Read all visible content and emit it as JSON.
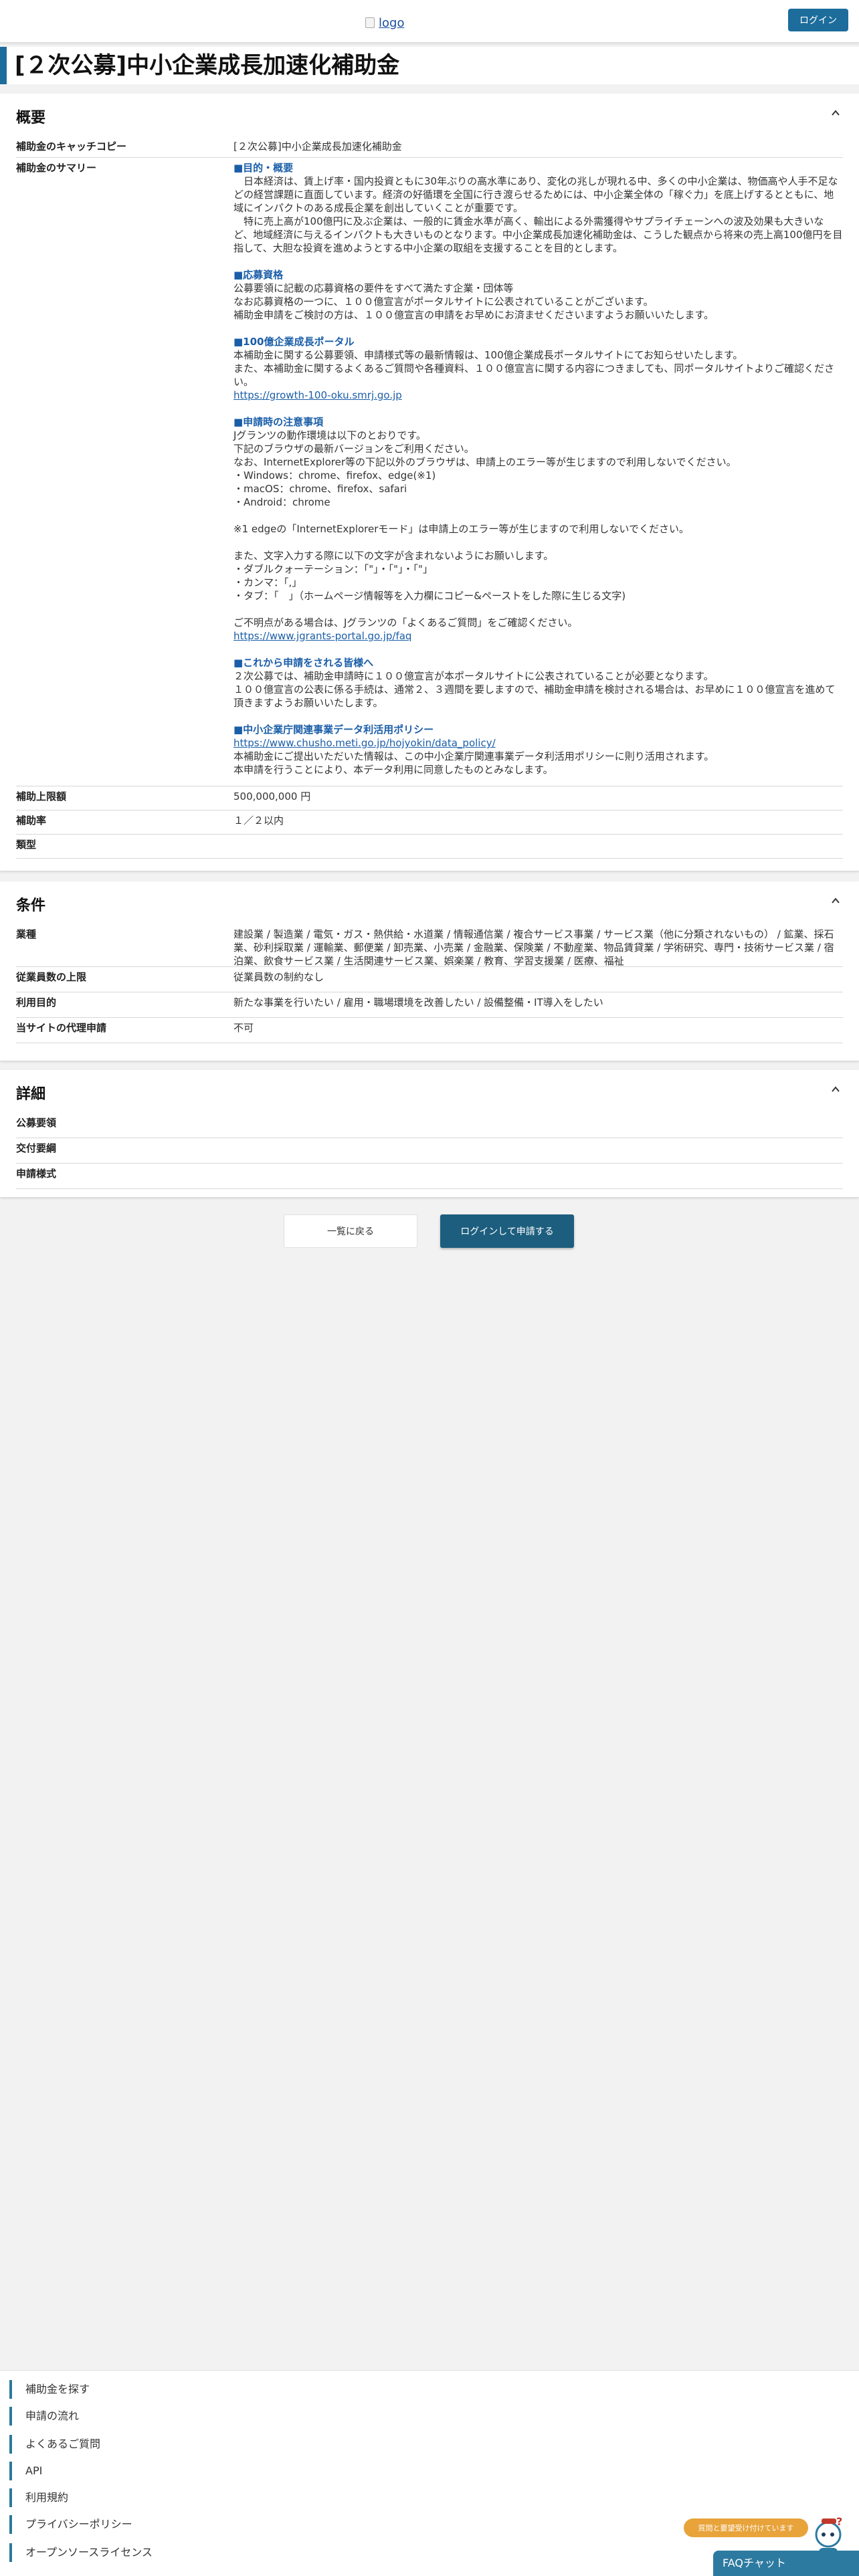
{
  "header": {
    "logo_alt": "logo",
    "login_label": "ログイン"
  },
  "page_title": "[２次公募]中小企業成長加速化補助金",
  "overview": {
    "title": "概要",
    "catchcopy_label": "補助金のキャッチコピー",
    "catchcopy_value": "[２次公募]中小企業成長加速化補助金",
    "summary_label": "補助金のサマリー",
    "summary": {
      "h1": "■目的・概要",
      "p1a": "　日本経済は、賃上げ率・国内投資ともに30年ぶりの高水準にあり、変化の兆しが現れる中、多くの中小企業は、物価高や人手不足などの経営課題に直面しています。経済の好循環を全国に行き渡らせるためには、中小企業全体の「稼ぐ力」を底上げするとともに、地域にインパクトのある成長企業を創出していくことが重要です。",
      "p1b": "　特に売上高が100億円に及ぶ企業は、一般的に賃金水準が高く、輸出による外需獲得やサプライチェーンへの波及効果も大きいなど、地域経済に与えるインパクトも大きいものとなります。中小企業成長加速化補助金は、こうした観点から将来の売上高100億円を目指して、大胆な投資を進めようとする中小企業の取組を支援することを目的とします。",
      "h2": "■応募資格",
      "p2a": "公募要領に記載の応募資格の要件をすべて満たす企業・団体等",
      "p2b": "なお応募資格の一つに、１００億宣言がポータルサイトに公表されていることがございます。",
      "p2c": "補助金申請をご検討の方は、１００億宣言の申請をお早めにお済ませくださいますようお願いいたします。",
      "h3": "■100億企業成長ポータル",
      "p3a": "本補助金に関する公募要領、申請様式等の最新情報は、100億企業成長ポータルサイトにてお知らせいたします。",
      "p3b": "また、本補助金に関するよくあるご質問や各種資料、１００億宣言に関する内容につきましても、同ポータルサイトよりご確認ください。",
      "link3": "https://growth-100-oku.smrj.go.jp",
      "h4": "■申請時の注意事項",
      "p4a": "Jグランツの動作環境は以下のとおりです。",
      "p4b": "下記のブラウザの最新バージョンをご利用ください。",
      "p4c": "なお、InternetExplorer等の下記以外のブラウザは、申請上のエラー等が生じますので利用しないでください。",
      "p4d": "・Windows：chrome、firefox、edge(※1)",
      "p4e": "・macOS：chrome、firefox、safari",
      "p4f": "・Android：chrome",
      "p4g": "※1 edgeの「InternetExplorerモード」は申請上のエラー等が生じますので利用しないでください。",
      "p4h": "また、文字入力する際に以下の文字が含まれないようにお願いします。",
      "p4i": "・ダブルクォーテーション：「\"」・「\"」・「\"」",
      "p4j": "・カンマ：「,」",
      "p4k": "・タブ：「　」（ホームページ情報等を入力欄にコピー&ペーストをした際に生じる文字)",
      "p4l": "ご不明点がある場合は、Jグランツの「よくあるご質問」をご確認ください。",
      "link4": "https://www.jgrants-portal.go.jp/faq",
      "h5": "■これから申請をされる皆様へ",
      "p5a": "２次公募では、補助金申請時に１００億宣言が本ポータルサイトに公表されていることが必要となります。",
      "p5b": "１００億宣言の公表に係る手続は、通常２、３週間を要しますので、補助金申請を検討される場合は、お早めに１００億宣言を進めて頂きますようお願いいたします。",
      "h6": "■中小企業庁関連事業データ利活用ポリシー",
      "link6": "https://www.chusho.meti.go.jp/hojyokin/data_policy/",
      "p6a": "本補助金にご提出いただいた情報は、この中小企業庁関連事業データ利活用ポリシーに則り活用されます。",
      "p6b": "本申請を行うことにより、本データ利用に同意したものとみなします。"
    },
    "limit_label": "補助上限額",
    "limit_value": "500,000,000 円",
    "rate_label": "補助率",
    "rate_value": "１／２以内",
    "type_label": "類型",
    "type_value": ""
  },
  "conditions": {
    "title": "条件",
    "industry_label": "業種",
    "industry_value": "建設業 / 製造業 / 電気・ガス・熱供給・水道業 / 情報通信業 / 複合サービス事業 / サービス業（他に分類されないもの） / 鉱業、採石業、砂利採取業 / 運輸業、郵便業 / 卸売業、小売業 / 金融業、保険業 / 不動産業、物品賃貸業 / 学術研究、専門・技術サービス業 / 宿泊業、飲食サービス業 / 生活関連サービス業、娯楽業 / 教育、学習支援業 / 医療、福祉",
    "employees_label": "従業員数の上限",
    "employees_value": "従業員数の制約なし",
    "purpose_label": "利用目的",
    "purpose_value": "新たな事業を行いたい / 雇用・職場環境を改善したい / 設備整備・IT導入をしたい",
    "proxy_label": "当サイトの代理申請",
    "proxy_value": "不可"
  },
  "details": {
    "title": "詳細",
    "guideline_label": "公募要領",
    "grant_label": "交付要綱",
    "form_label": "申請様式"
  },
  "actions": {
    "back_label": "一覧に戻る",
    "apply_label": "ログインして申請する"
  },
  "footer": {
    "links": [
      "補助金を探す",
      "申請の流れ",
      "よくあるご質問",
      "API",
      "利用規約",
      "プライバシーポリシー",
      "オープンソースライセンス"
    ]
  },
  "chat": {
    "badge": "質問と要望受け付けています",
    "label": "FAQチャット"
  },
  "colors": {
    "accent": "#1d6d9c",
    "heading_link": "#1a5ea8",
    "badge": "#e8a33a"
  }
}
